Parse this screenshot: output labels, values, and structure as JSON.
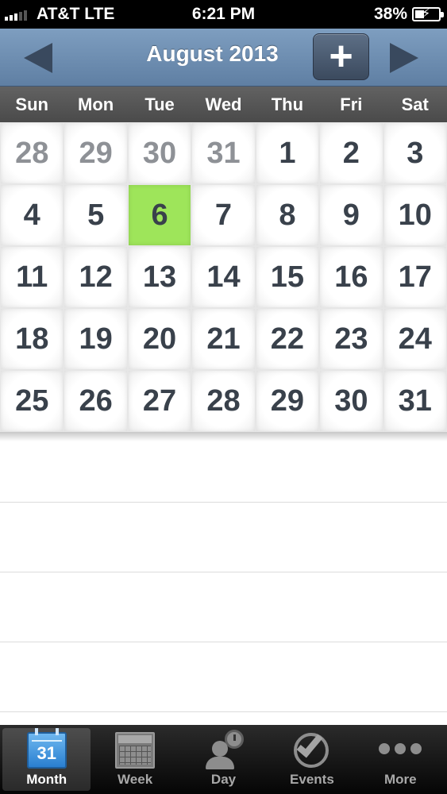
{
  "status_bar": {
    "carrier": "AT&T  LTE",
    "time": "6:21 PM",
    "battery_percent": "38%",
    "battery_level": 0.38
  },
  "header": {
    "month_title": "August 2013",
    "add_label": "+",
    "prev_icon": "triangle-left-icon",
    "next_icon": "triangle-right-icon"
  },
  "weekdays": [
    "Sun",
    "Mon",
    "Tue",
    "Wed",
    "Thu",
    "Fri",
    "Sat"
  ],
  "calendar": {
    "weeks": [
      [
        "28",
        "29",
        "30",
        "31",
        "1",
        "2",
        "3"
      ],
      [
        "4",
        "5",
        "6",
        "7",
        "8",
        "9",
        "10"
      ],
      [
        "11",
        "12",
        "13",
        "14",
        "15",
        "16",
        "17"
      ],
      [
        "18",
        "19",
        "20",
        "21",
        "22",
        "23",
        "24"
      ],
      [
        "25",
        "26",
        "27",
        "28",
        "29",
        "30",
        "31"
      ]
    ],
    "selected_day": "6",
    "selected_color": "#9ee55a"
  },
  "tabs": [
    {
      "label": "Month",
      "icon": "calendar-icon",
      "icon_text": "31",
      "active": true
    },
    {
      "label": "Week",
      "icon": "week-grid-icon",
      "active": false
    },
    {
      "label": "Day",
      "icon": "person-clock-icon",
      "active": false
    },
    {
      "label": "Events",
      "icon": "checkmark-icon",
      "active": false
    },
    {
      "label": "More",
      "icon": "more-dots-icon",
      "active": false
    }
  ],
  "colors": {
    "header_blue": "#6f8fb2",
    "weekday_bar": "#555555",
    "day_text": "#39414b",
    "other_month_text": "#8e9196"
  }
}
